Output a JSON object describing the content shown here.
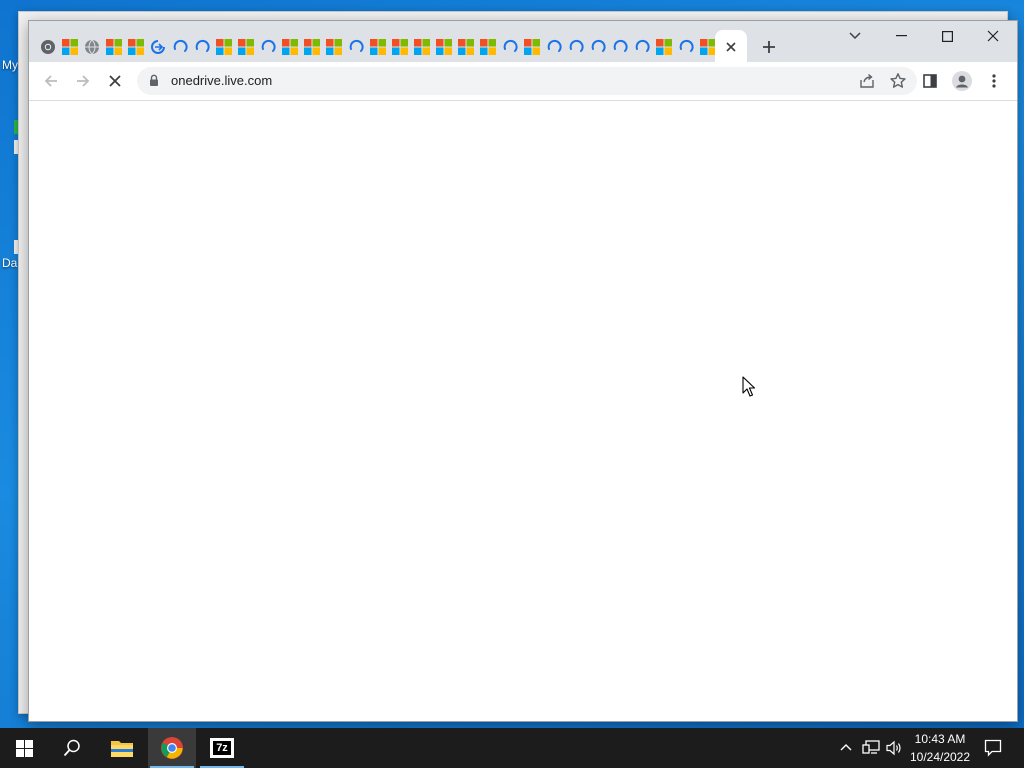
{
  "desktop": {
    "label_top": "My",
    "label_bottom": "Da"
  },
  "browser": {
    "tabs": [
      {
        "icon": "chrome-icon"
      },
      {
        "icon": "microsoft-logo-icon"
      },
      {
        "icon": "globe-icon"
      },
      {
        "icon": "microsoft-logo-icon"
      },
      {
        "icon": "microsoft-logo-icon"
      },
      {
        "icon": "onedrive-sync-icon"
      },
      {
        "icon": "loading-spinner-icon"
      },
      {
        "icon": "loading-spinner-icon"
      },
      {
        "icon": "microsoft-logo-icon"
      },
      {
        "icon": "microsoft-logo-icon"
      },
      {
        "icon": "loading-spinner-icon"
      },
      {
        "icon": "microsoft-logo-icon"
      },
      {
        "icon": "microsoft-logo-icon"
      },
      {
        "icon": "microsoft-logo-icon"
      },
      {
        "icon": "loading-spinner-icon"
      },
      {
        "icon": "microsoft-logo-icon"
      },
      {
        "icon": "microsoft-logo-icon"
      },
      {
        "icon": "microsoft-logo-icon"
      },
      {
        "icon": "microsoft-logo-icon"
      },
      {
        "icon": "microsoft-logo-icon"
      },
      {
        "icon": "microsoft-logo-icon"
      },
      {
        "icon": "loading-spinner-icon"
      },
      {
        "icon": "microsoft-logo-icon"
      },
      {
        "icon": "loading-spinner-icon"
      },
      {
        "icon": "loading-spinner-icon"
      },
      {
        "icon": "loading-spinner-icon"
      },
      {
        "icon": "loading-spinner-icon"
      },
      {
        "icon": "loading-spinner-icon"
      },
      {
        "icon": "microsoft-logo-icon"
      },
      {
        "icon": "loading-spinner-icon"
      },
      {
        "icon": "microsoft-logo-icon"
      }
    ],
    "active_tab": {
      "close_icon": "close-icon"
    },
    "address": {
      "url": "onedrive.live.com"
    }
  },
  "taskbar": {
    "clock_time": "10:43 AM",
    "clock_date": "10/24/2022",
    "sevenzip_label": "7z"
  },
  "colors": {
    "desktop": "#1683d8",
    "taskbar": "#1c1c1c",
    "tabstrip": "#dee1e6",
    "omnibox": "#f1f3f4",
    "accent": "#76b9ed"
  }
}
